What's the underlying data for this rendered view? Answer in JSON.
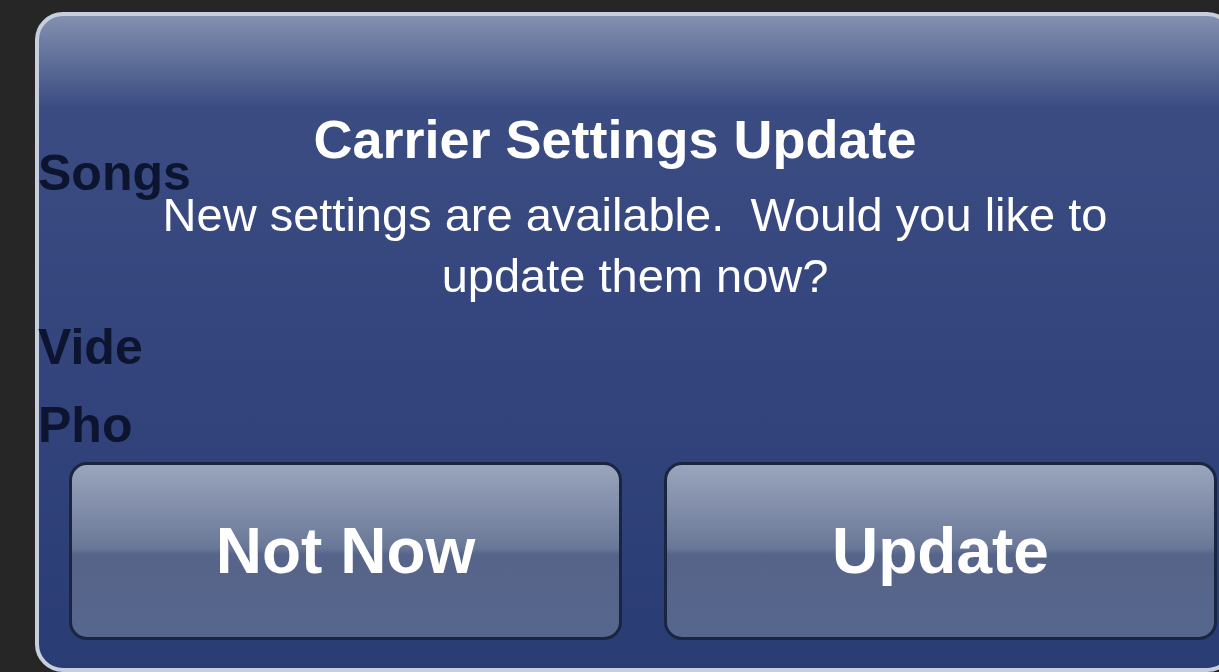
{
  "background_list": [
    {
      "label": "Songs"
    },
    {
      "label": "Vide"
    },
    {
      "label": "Pho"
    }
  ],
  "alert": {
    "title": "Carrier Settings Update",
    "message": "New settings are available.  Would you like to update them now?",
    "buttons": [
      {
        "label": "Not Now"
      },
      {
        "label": "Update"
      }
    ]
  }
}
